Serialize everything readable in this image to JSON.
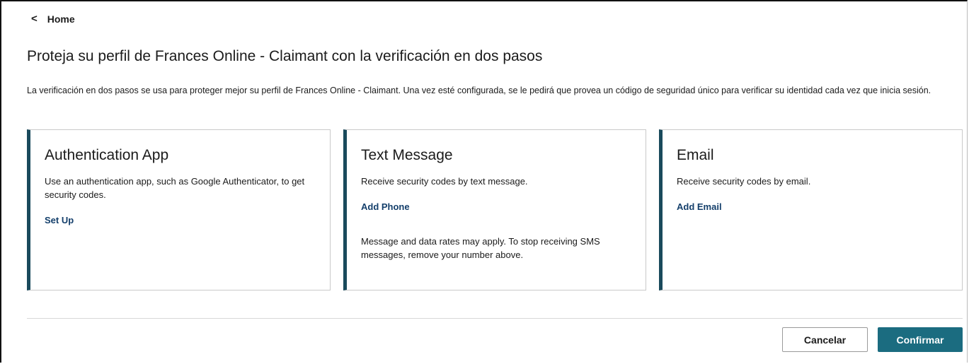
{
  "nav": {
    "back_icon": "chevron-left-icon",
    "home_label": "Home"
  },
  "header": {
    "title": "Proteja su perfil de Frances Online - Claimant con la verificación en dos pasos",
    "intro": "La verificación en dos pasos se usa para proteger mejor su perfil de Frances Online - Claimant. Una vez esté configurada, se le pedirá que provea un código de seguridad único para verificar su identidad cada vez que inicia sesión."
  },
  "options": [
    {
      "title": "Authentication App",
      "description": "Use an authentication app, such as Google Authenticator, to get security codes.",
      "action": "Set Up"
    },
    {
      "title": "Text Message",
      "description": "Receive security codes by text message.",
      "action": "Add Phone",
      "note": "Message and data rates may apply. To stop receiving SMS messages, remove your number above."
    },
    {
      "title": "Email",
      "description": "Receive security codes by email.",
      "action": "Add Email"
    }
  ],
  "footer": {
    "cancel_label": "Cancelar",
    "confirm_label": "Confirmar"
  },
  "colors": {
    "accent": "#1a4a5c",
    "primary_button": "#1b6c80",
    "link": "#143f6b"
  }
}
